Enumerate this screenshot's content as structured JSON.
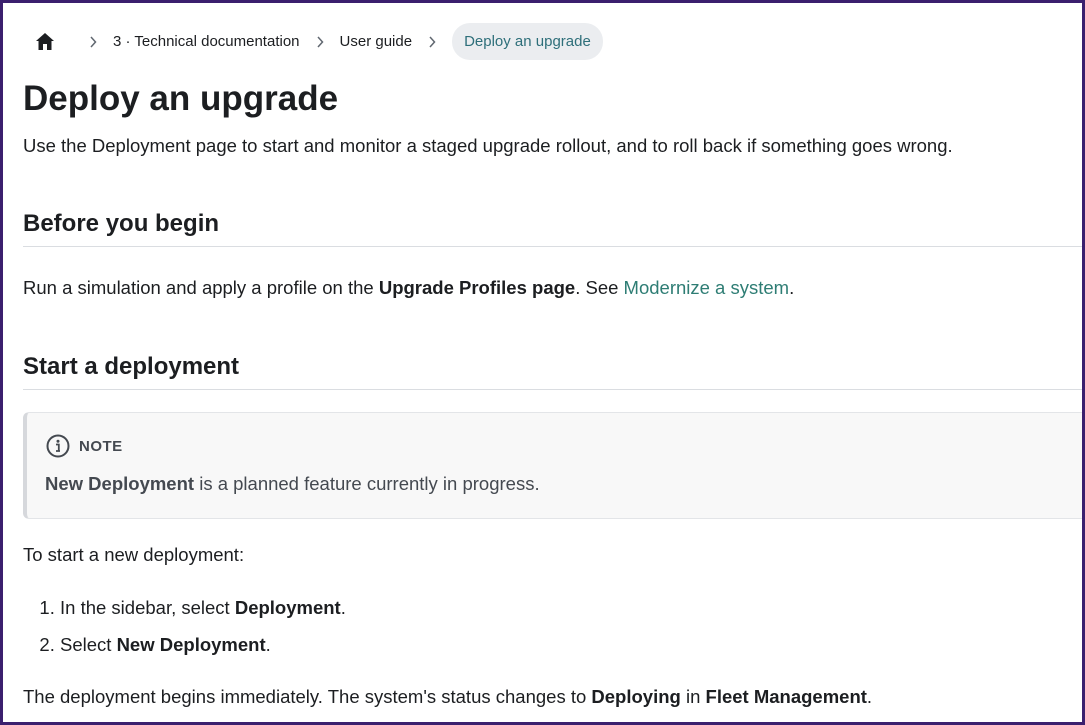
{
  "breadcrumbs": {
    "items": [
      "3 · Technical documentation",
      "User guide"
    ],
    "active": "Deploy an upgrade"
  },
  "page": {
    "title": "Deploy an upgrade",
    "intro": "Use the Deployment page to start and monitor a staged upgrade rollout, and to roll back if something goes wrong."
  },
  "before": {
    "heading": "Before you begin",
    "text_1": "Run a simulation and apply a profile on the ",
    "bold": "Upgrade Profiles page",
    "text_2": ". See ",
    "link": "Modernize a system",
    "text_3": "."
  },
  "start": {
    "heading": "Start a deployment",
    "note_label": "NOTE",
    "note_bold": "New Deployment",
    "note_text": " is a planned feature currently in progress.",
    "lead": "To start a new deployment:",
    "steps": [
      {
        "text": "In the sidebar, select ",
        "bold": "Deployment",
        "end": "."
      },
      {
        "text": "Select ",
        "bold": "New Deployment",
        "end": "."
      }
    ],
    "result_1": "The deployment begins immediately. The system's status changes to ",
    "result_bold_1": "Deploying",
    "result_2": " in ",
    "result_bold_2": "Fleet Management",
    "result_3": "."
  },
  "colors": {
    "frame": "#3b1f6e",
    "link": "#2e7d74",
    "active_crumb_bg": "#ebedf0"
  },
  "icons": [
    "home-icon",
    "chevron-right-icon",
    "info-circle-icon"
  ]
}
